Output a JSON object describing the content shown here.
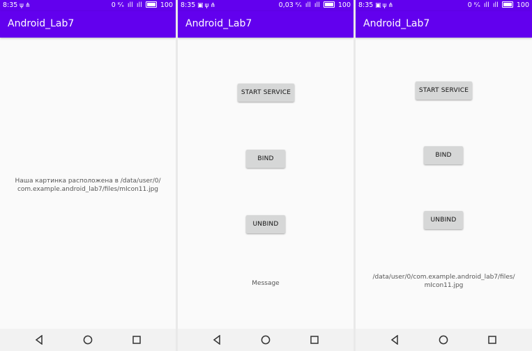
{
  "app": {
    "title": "Android_Lab7"
  },
  "colors": {
    "primary": "#6200ee",
    "button_bg": "#d6d7d7",
    "background": "#fafafa"
  },
  "screens": [
    {
      "status": {
        "time": "8:35",
        "data_rate": "0 ᴷ⁄ₛ",
        "battery": "100"
      },
      "message": "Наша картинка расположена в /data/user/0/\ncom.example.android_lab7/files/mIcon11.jpg"
    },
    {
      "status": {
        "time": "8:35",
        "data_rate": "0,03 ᴷ⁄ₛ",
        "battery": "100"
      },
      "buttons": {
        "start": "START SERVICE",
        "bind": "BIND",
        "unbind": "UNBIND"
      },
      "message": "Message"
    },
    {
      "status": {
        "time": "8:35",
        "data_rate": "0 ᴷ⁄ₛ",
        "battery": "100"
      },
      "buttons": {
        "start": "START SERVICE",
        "bind": "BIND",
        "unbind": "UNBIND"
      },
      "message": "/data/user/0/com.example.android_lab7/files/\nmIcon11.jpg"
    }
  ],
  "icons": {
    "status_left": [
      "usb-icon",
      "share-icon",
      "image-icon"
    ],
    "navigation": [
      "back-icon",
      "home-icon",
      "recents-icon"
    ]
  }
}
